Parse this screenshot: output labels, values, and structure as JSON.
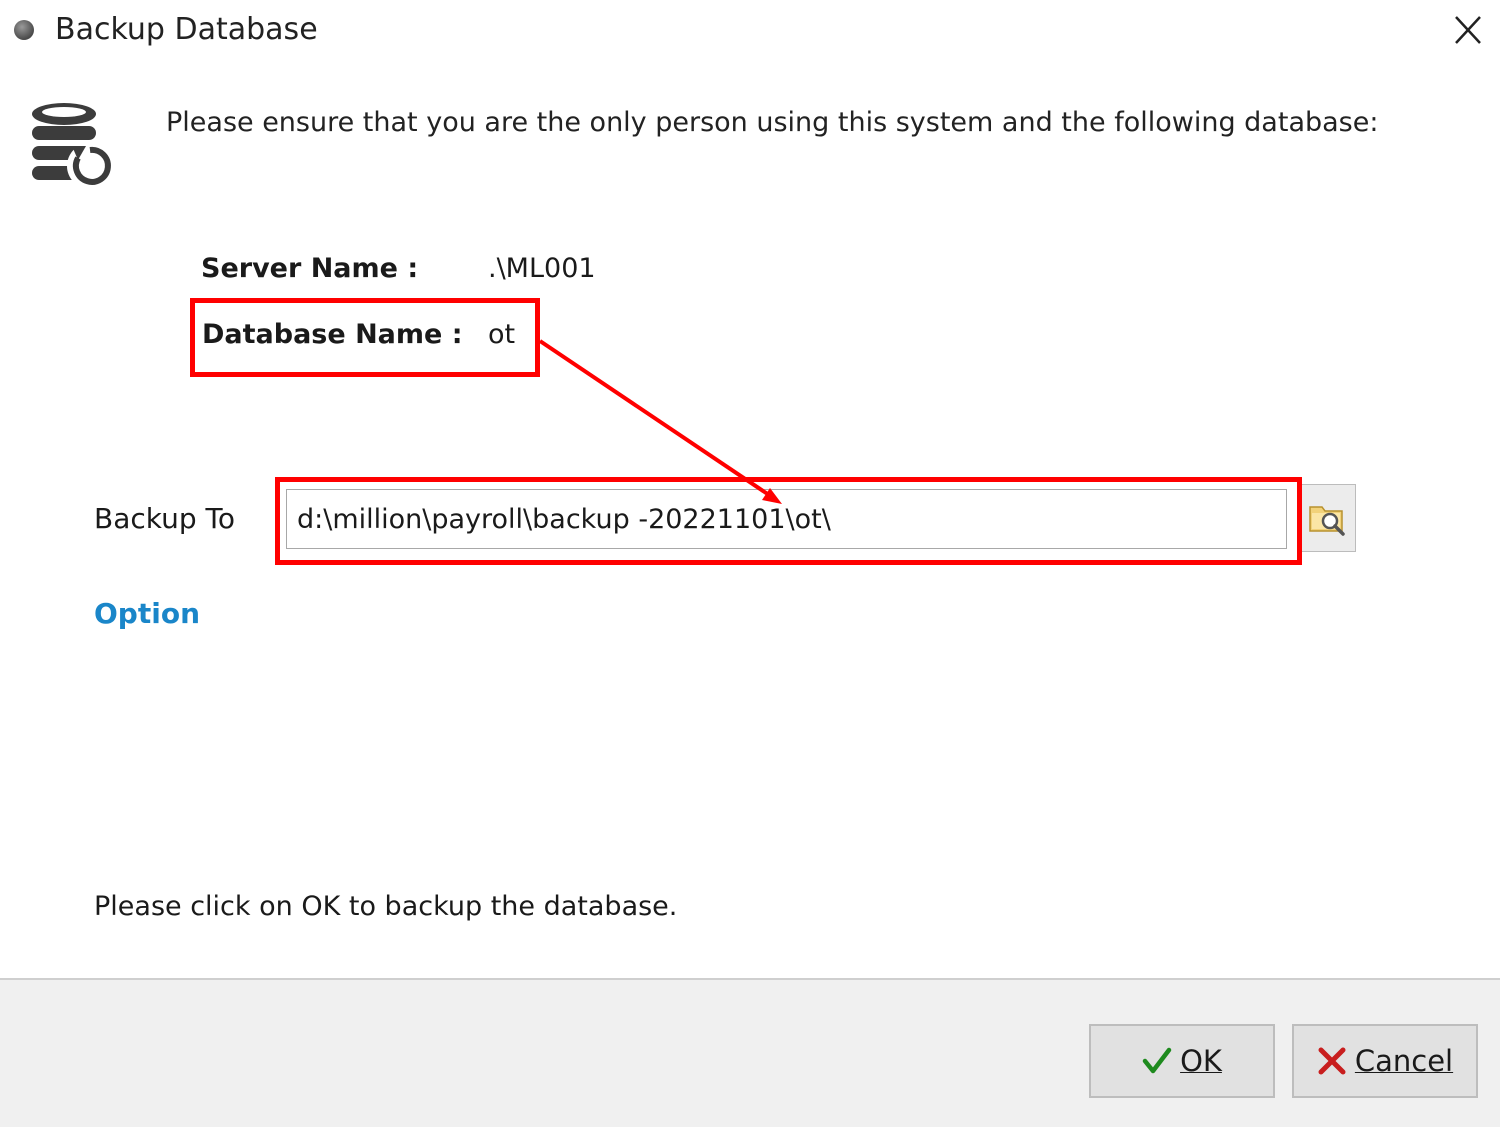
{
  "window": {
    "title": "Backup Database"
  },
  "header": {
    "instruction": "Please ensure that you are the only person using this system and the following database:"
  },
  "info": {
    "server_label": "Server Name :",
    "server_value": ".\\ML001",
    "database_label": "Database Name :",
    "database_value": "ot"
  },
  "backup": {
    "label": "Backup To",
    "path": "d:\\million\\payroll\\backup -20221101\\ot\\"
  },
  "option_link": "Option",
  "footer_text": "Please click on OK to backup the database.",
  "buttons": {
    "ok": "OK",
    "cancel": "Cancel"
  },
  "icons": {
    "title": "app-dot-icon",
    "close": "close-icon",
    "header": "database-restore-icon",
    "browse": "folder-search-icon",
    "ok": "checkmark-icon",
    "cancel": "x-icon"
  },
  "colors": {
    "annotation": "#ff0000",
    "link": "#1a86c9",
    "ok_check": "#1e8a1e",
    "cancel_x": "#c81e1e"
  }
}
